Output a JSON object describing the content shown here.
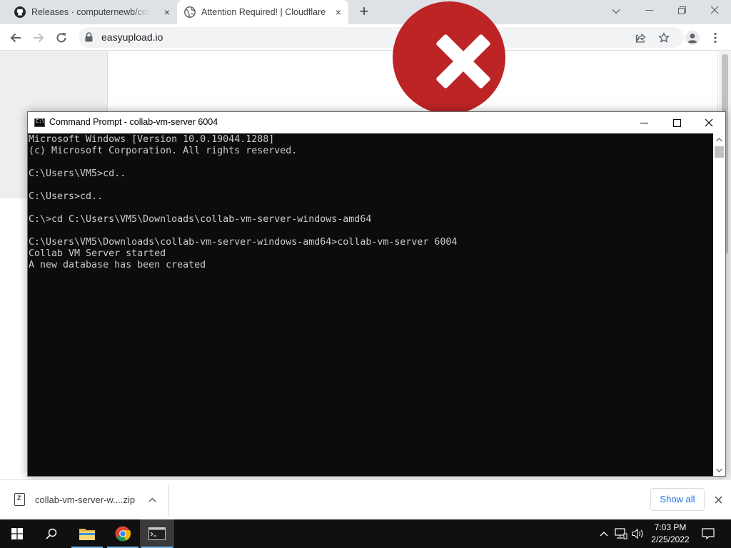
{
  "browser": {
    "tabs": [
      {
        "label": "Releases · computernewb/collab-vm-server",
        "close": "×"
      },
      {
        "label": "Attention Required! | Cloudflare",
        "close": "×"
      }
    ],
    "new_tab": "+",
    "address": "easyupload.io"
  },
  "cmd": {
    "title": "Command Prompt - collab-vm-server  6004",
    "icon_text": "C:\\",
    "lines": [
      "Microsoft Windows [Version 10.0.19044.1288]",
      "(c) Microsoft Corporation. All rights reserved.",
      "",
      "C:\\Users\\VM5>cd..",
      "",
      "C:\\Users>cd..",
      "",
      "C:\\>cd C:\\Users\\VM5\\Downloads\\collab-vm-server-windows-amd64",
      "",
      "C:\\Users\\VM5\\Downloads\\collab-vm-server-windows-amd64>collab-vm-server 6004",
      "Collab VM Server started",
      "A new database has been created"
    ]
  },
  "download_shelf": {
    "file_icon_text": "Z",
    "file_name": "collab-vm-server-w....zip",
    "show_all": "Show all"
  },
  "taskbar": {
    "time": "7:03 PM",
    "date": "2/25/2022"
  },
  "colors": {
    "error_red": "#bd2426",
    "console_bg": "#0c0c0c",
    "console_text": "#cccccc",
    "link_blue": "#1a73e8"
  }
}
